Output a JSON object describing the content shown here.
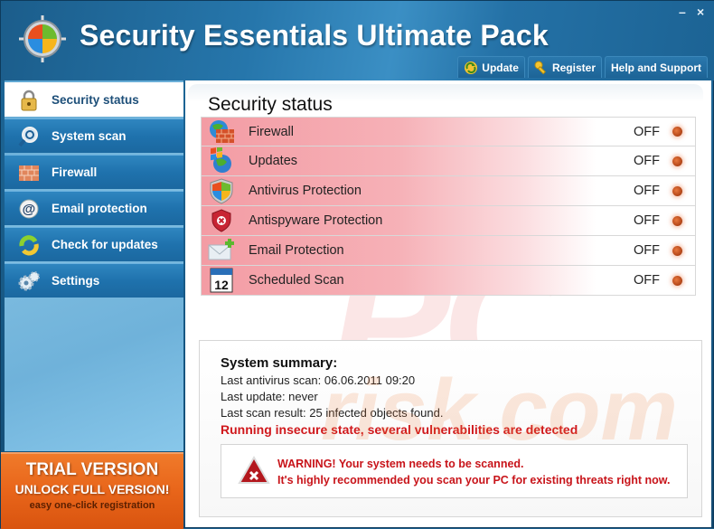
{
  "window": {
    "title": "Security Essentials Ultimate Pack",
    "minimize_label": "–",
    "close_label": "×"
  },
  "topnav": [
    {
      "label": "Update",
      "icon": "update-arrows-icon"
    },
    {
      "label": "Register",
      "icon": "key-icon"
    },
    {
      "label": "Help and Support",
      "icon": ""
    }
  ],
  "sidebar": {
    "items": [
      {
        "label": "Security status",
        "icon": "padlock-icon",
        "active": true
      },
      {
        "label": "System scan",
        "icon": "magnifier-icon",
        "active": false
      },
      {
        "label": "Firewall",
        "icon": "brick-wall-icon",
        "active": false
      },
      {
        "label": "Email protection",
        "icon": "at-sign-icon",
        "active": false
      },
      {
        "label": "Check for updates",
        "icon": "update-arrows-icon",
        "active": false
      },
      {
        "label": "Settings",
        "icon": "gears-icon",
        "active": false
      }
    ]
  },
  "trial": {
    "line1": "TRIAL VERSION",
    "line2": "UNLOCK FULL VERSION!",
    "line3": "easy one-click registration",
    "color": "#e8651a"
  },
  "main": {
    "title": "Security status",
    "status_rows": [
      {
        "label": "Firewall",
        "value": "OFF",
        "icon": "firewall-globe-icon"
      },
      {
        "label": "Updates",
        "value": "OFF",
        "icon": "windows-update-icon"
      },
      {
        "label": "Antivirus Protection",
        "value": "OFF",
        "icon": "windows-shield-icon"
      },
      {
        "label": "Antispyware Protection",
        "value": "OFF",
        "icon": "red-x-shield-icon"
      },
      {
        "label": "Email Protection",
        "value": "OFF",
        "icon": "envelope-plus-icon"
      },
      {
        "label": "Scheduled Scan",
        "value": "OFF",
        "icon": "calendar-icon"
      }
    ],
    "calendar_day": "12",
    "summary": {
      "title": "System summary:",
      "last_scan": "Last antivirus scan: 06.06.2011 09:20",
      "last_update": "Last update: never",
      "last_result": "Last scan result: 25 infected objects found.",
      "alert": "Running insecure state, several vulnerabilities are detected"
    },
    "warning": {
      "line1": "WARNING! Your system needs to be scanned.",
      "line2": "It's highly recommended you scan your PC for existing threats right now."
    }
  },
  "watermark": {
    "line1": "PC",
    "line2": "risk.com"
  },
  "colors": {
    "title_bar": "#1f6a9c",
    "alert_red": "#d0181c",
    "off_dot": "#b84a1b"
  }
}
